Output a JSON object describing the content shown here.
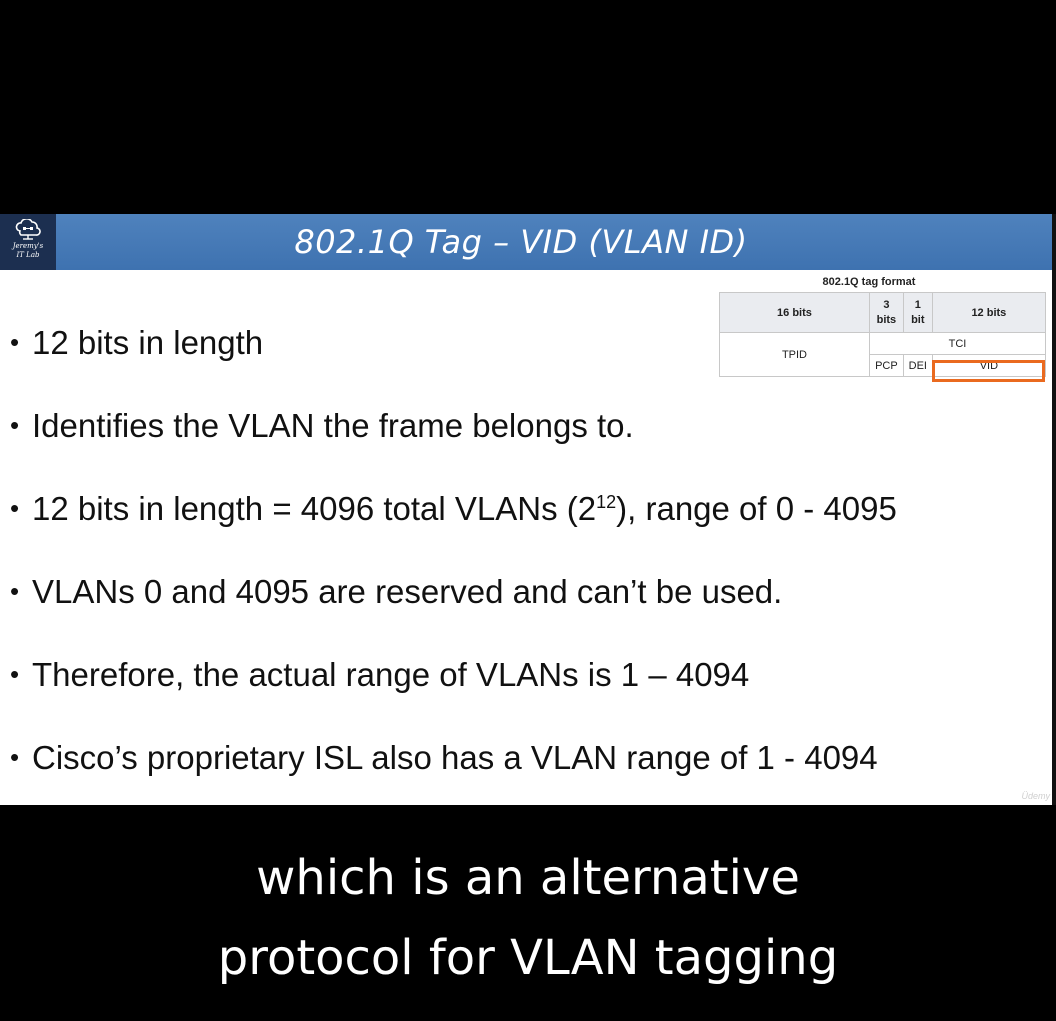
{
  "slide": {
    "title": "802.1Q Tag – VID (VLAN ID)",
    "logo": {
      "icon": "cloud-network-icon",
      "line1": "Jeremy's",
      "line2": "IT Lab"
    },
    "bullets": [
      {
        "text": "12 bits in length"
      },
      {
        "text": "Identifies the VLAN the frame belongs to."
      },
      {
        "pre": "12 bits in length = 4096 total VLANs (2",
        "sup": "12",
        "post": "), range of 0 - 4095"
      },
      {
        "text": "VLANs 0 and 4095 are reserved and can’t be used."
      },
      {
        "text": "Therefore, the actual range of VLANs is 1 – 4094"
      },
      {
        "text": "Cisco’s proprietary ISL also has a VLAN range of 1 - 4094"
      }
    ],
    "tag_table": {
      "caption": "802.1Q tag format",
      "header": {
        "tpid_bits": "16 bits",
        "pcp_bits_num": "3",
        "pcp_bits_unit": "bits",
        "dei_bits_num": "1",
        "dei_bits_unit": "bit",
        "vid_bits": "12 bits"
      },
      "tpid": "TPID",
      "tci": "TCI",
      "pcp": "PCP",
      "dei": "DEI",
      "vid": "VID",
      "highlight_color": "#ea6a1f"
    },
    "watermark": "Üdemy"
  },
  "subtitle": {
    "line1": "which is an alternative",
    "line2": "protocol for VLAN tagging"
  },
  "colors": {
    "title_bar": "#4f82bd",
    "logo_bg": "#1c2f50",
    "background": "#000000"
  }
}
